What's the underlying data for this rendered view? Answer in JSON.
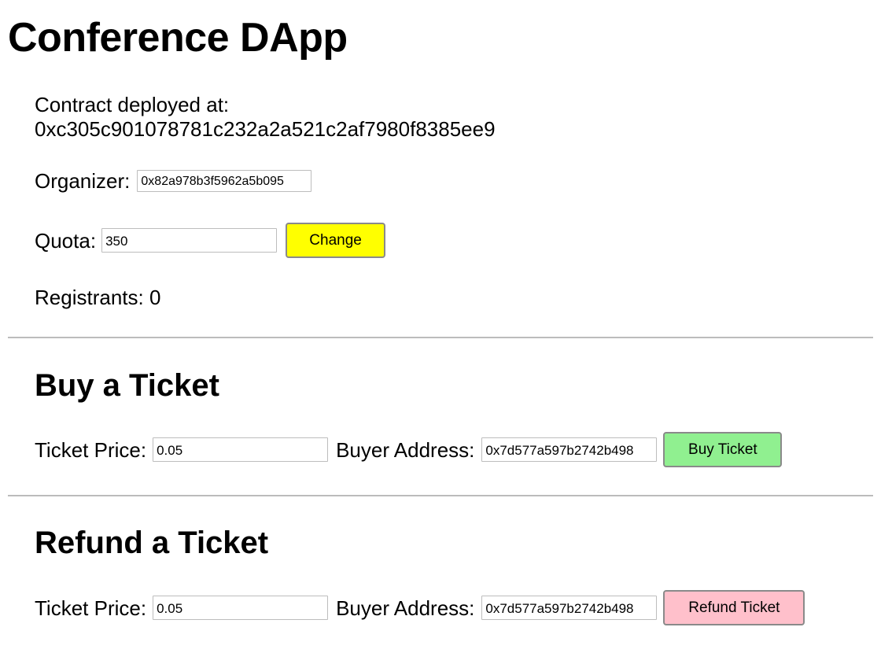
{
  "app": {
    "title": "Conference DApp"
  },
  "contract": {
    "label": "Contract deployed at:",
    "address": "0xc305c901078781c232a2a521c2af7980f8385ee9"
  },
  "organizer": {
    "label": "Organizer:",
    "value": "0x82a978b3f5962a5b095"
  },
  "quota": {
    "label": "Quota:",
    "value": "350",
    "button_label": "Change",
    "button_color": "#ffff00"
  },
  "registrants": {
    "label": "Registrants: 0"
  },
  "buy": {
    "heading": "Buy a Ticket",
    "price_label": "Ticket Price:",
    "price_value": "0.05",
    "buyer_label": "Buyer Address:",
    "buyer_value": "0x7d577a597b2742b498",
    "button_label": "Buy Ticket",
    "button_color": "#90f090"
  },
  "refund": {
    "heading": "Refund a Ticket",
    "price_label": "Ticket Price:",
    "price_value": "0.05",
    "buyer_label": "Buyer Address:",
    "buyer_value": "0x7d577a597b2742b498",
    "button_label": "Refund Ticket",
    "button_color": "#ffc0cb"
  }
}
